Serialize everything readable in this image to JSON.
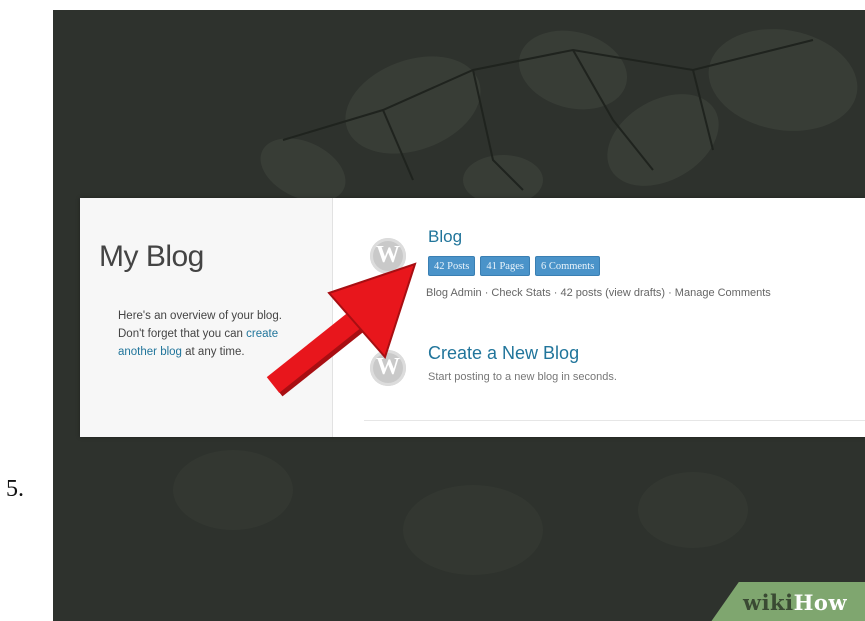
{
  "step": {
    "number": "5."
  },
  "left_panel": {
    "title": "My Blog",
    "overview_before": "Here's an overview of your blog. Don't forget that you can ",
    "overview_link": "create another blog",
    "overview_after": " at any time."
  },
  "blog": {
    "name": "Blog",
    "badges": [
      "42 Posts",
      "41 Pages",
      "6 Comments"
    ],
    "actions": "Blog Admin · Check Stats · 42 posts (view drafts) · Manage Comments"
  },
  "create_blog": {
    "title": "Create a New Blog",
    "description": "Start posting to a new blog in seconds."
  },
  "icons": {
    "logo": "wordpress-logo-icon",
    "arrow": "red-pointer-arrow-icon"
  },
  "colors": {
    "background": "#2e322d",
    "link": "#21759b",
    "badge": "#4a93c9",
    "arrow": "#e8161c",
    "watermark": "#7fa66f"
  },
  "watermark": {
    "part1": "wiki",
    "part2": "How"
  }
}
